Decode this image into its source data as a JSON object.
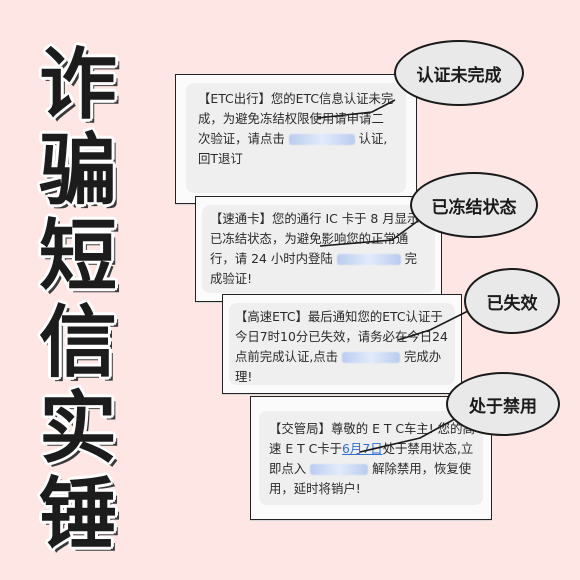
{
  "headline": [
    "诈",
    "骗",
    "短",
    "信",
    "实",
    "锤"
  ],
  "cards": [
    {
      "segments": [
        "【ETC出行】您的ETC信息认证未完成，为避免冻结权限使用请申请二次验证，请点击 ",
        " 认证,回T退订"
      ]
    },
    {
      "segments": [
        "【速通卡】您的通行 IC 卡于 8 月显示已冻结状态，为避免影响您的正常通行，请 24 小时内登陆 ",
        " 完成验证!"
      ]
    },
    {
      "segments": [
        "【高速ETC】最后通知您的ETC认证于今日7时10分已失效，请务必在今日24点前完成认证,点击 ",
        " 完成办理!"
      ]
    },
    {
      "segments": [
        "【交管局】尊敬的 E T C车主! 您的高速 E T C卡于",
        "6月7日",
        "处于禁用状态,立即点入 ",
        " 解除禁用，恢复使用，延时将销户!"
      ]
    }
  ],
  "bubbles": [
    "认证未完成",
    "已冻结状态",
    "已失效",
    "处于禁用"
  ],
  "colors": {
    "background": "#fde6e3",
    "link": "#2f6fd6"
  }
}
